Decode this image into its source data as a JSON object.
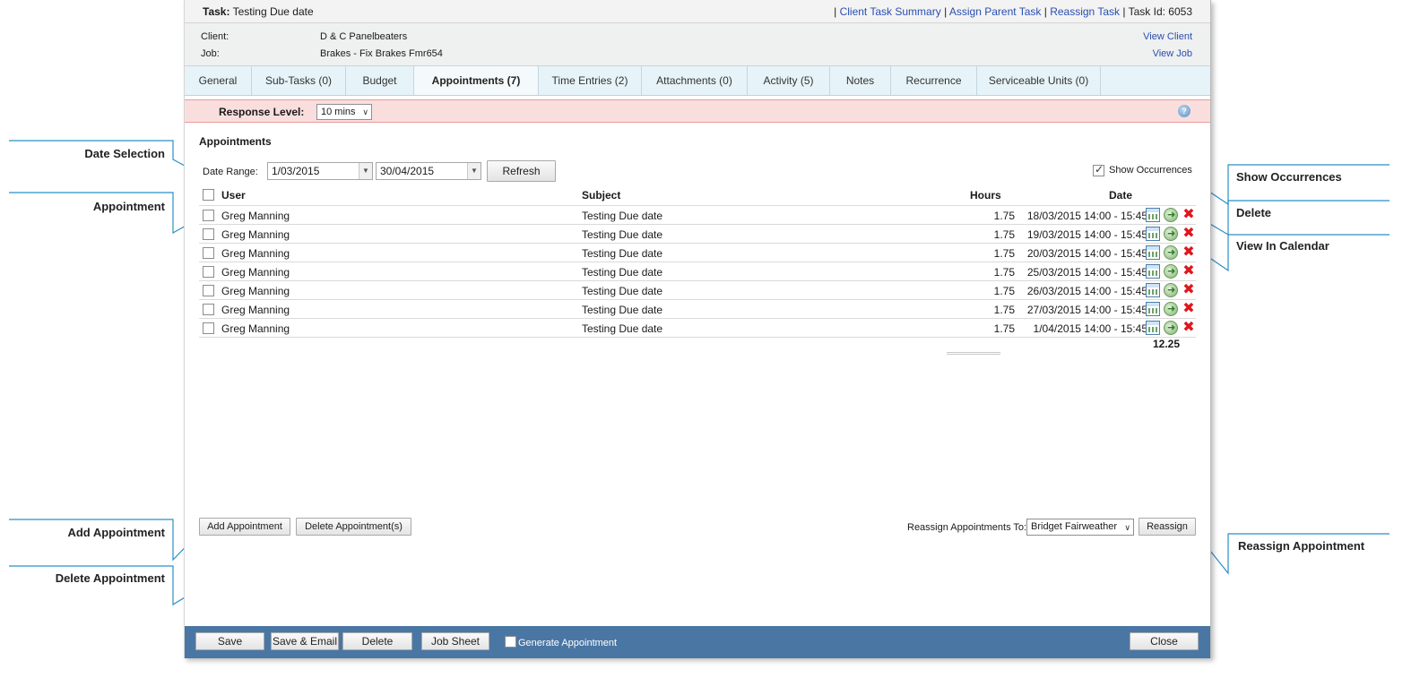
{
  "header": {
    "task_label": "Task:",
    "task_value": "Testing Due date",
    "links": [
      "Client Task Summary",
      "Assign Parent Task",
      "Reassign Task"
    ],
    "separator": "|",
    "task_id": "Task Id: 6053"
  },
  "info": {
    "client_label": "Client:",
    "client_value": "D & C Panelbeaters",
    "job_label": "Job:",
    "job_value": "Brakes - Fix Brakes Fmr654",
    "view_client": "View Client",
    "view_job": "View Job"
  },
  "tabs": [
    {
      "label": "General",
      "active": false
    },
    {
      "label": "Sub-Tasks (0)",
      "active": false
    },
    {
      "label": "Budget",
      "active": false
    },
    {
      "label": "Appointments (7)",
      "active": true
    },
    {
      "label": "Time Entries (2)",
      "active": false
    },
    {
      "label": "Attachments (0)",
      "active": false
    },
    {
      "label": "Activity (5)",
      "active": false
    },
    {
      "label": "Notes",
      "active": false
    },
    {
      "label": "Recurrence",
      "active": false
    },
    {
      "label": "Serviceable Units (0)",
      "active": false
    }
  ],
  "response": {
    "label": "Response Level:",
    "value": "10 mins",
    "help": "?"
  },
  "appointments": {
    "heading": "Appointments",
    "date_range_label": "Date Range:",
    "date_from": "1/03/2015",
    "date_to": "30/04/2015",
    "refresh": "Refresh",
    "show_occurrences": "Show Occurrences",
    "show_occurrences_checked": true,
    "columns": {
      "user": "User",
      "subject": "Subject",
      "hours": "Hours",
      "date": "Date"
    },
    "rows": [
      {
        "user": "Greg Manning",
        "subject": "Testing Due date",
        "hours": "1.75",
        "date": "18/03/2015 14:00 - 15:45"
      },
      {
        "user": "Greg Manning",
        "subject": "Testing Due date",
        "hours": "1.75",
        "date": "19/03/2015 14:00 - 15:45"
      },
      {
        "user": "Greg Manning",
        "subject": "Testing Due date",
        "hours": "1.75",
        "date": "20/03/2015 14:00 - 15:45"
      },
      {
        "user": "Greg Manning",
        "subject": "Testing Due date",
        "hours": "1.75",
        "date": "25/03/2015 14:00 - 15:45"
      },
      {
        "user": "Greg Manning",
        "subject": "Testing Due date",
        "hours": "1.75",
        "date": "26/03/2015 14:00 - 15:45"
      },
      {
        "user": "Greg Manning",
        "subject": "Testing Due date",
        "hours": "1.75",
        "date": "27/03/2015 14:00 - 15:45"
      },
      {
        "user": "Greg Manning",
        "subject": "Testing Due date",
        "hours": "1.75",
        "date": "1/04/2015 14:00 - 15:45"
      }
    ],
    "total_hours": "12.25",
    "add_button": "Add Appointment",
    "delete_button": "Delete Appointment(s)",
    "reassign_label": "Reassign Appointments To:",
    "reassign_value": "Bridget Fairweather",
    "reassign_button": "Reassign"
  },
  "footer": {
    "save": "Save",
    "save_email": "Save & Email",
    "delete": "Delete",
    "job_sheet": "Job Sheet",
    "generate_appointment": "Generate Appointment",
    "close": "Close"
  },
  "callouts": {
    "date_selection": "Date Selection",
    "appointment": "Appointment",
    "add_appointment": "Add Appointment",
    "delete_appointment": "Delete Appointment",
    "show_occurrences": "Show Occurrences",
    "delete": "Delete",
    "view_in_calendar": "View In Calendar",
    "reassign_appointment": "Reassign Appointment"
  },
  "colors": {
    "callout_line": "#2a8fc8",
    "footer_bar": "#4a76a4",
    "tab_bar": "#e6f3f8",
    "response_bar": "#fadede",
    "link": "#2a4fb0"
  }
}
